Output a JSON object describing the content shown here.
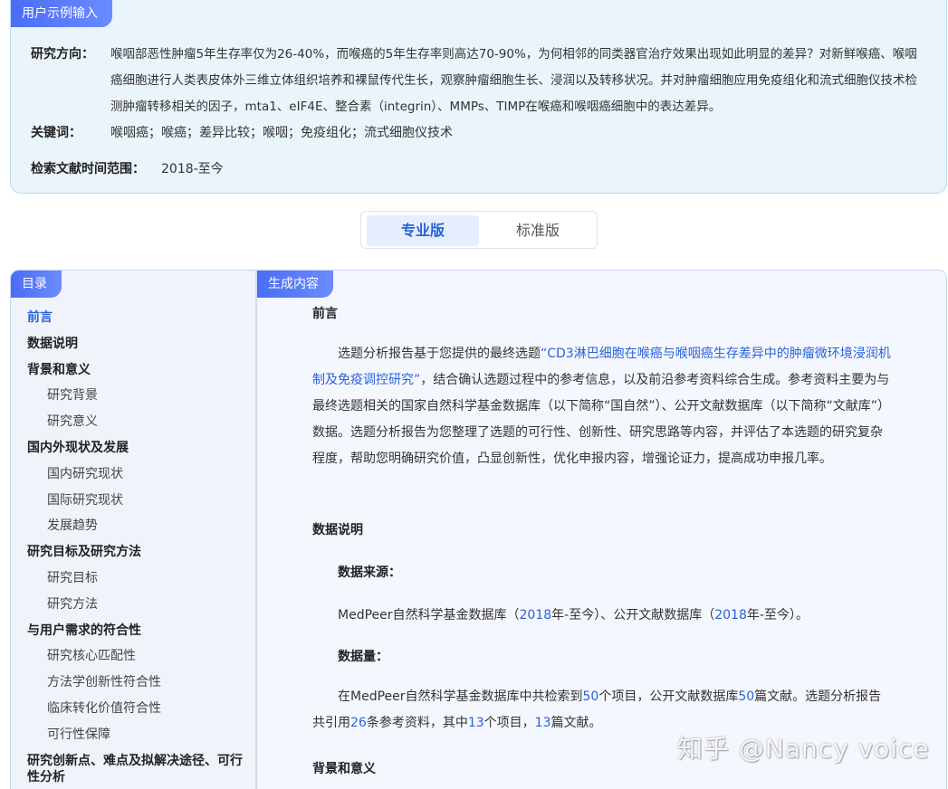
{
  "input_panel": {
    "tag": "用户示例输入",
    "direction_label": "研究方向：",
    "direction_text": "喉咽部恶性肿瘤5年生存率仅为26-40%，而喉癌的5年生存率则高达70-90%，为何相邻的同类器官治疗效果出现如此明显的差异？对新鲜喉癌、喉咽癌细胞进行人类表皮体外三维立体组织培养和裸鼠传代生长，观察肿瘤细胞生长、浸润以及转移状况。并对肿瘤细胞应用免疫组化和流式细胞仪技术检测肿瘤转移相关的因子，mta1、eIF4E、整合素（integrin）、MMPs、TIMP在喉癌和喉咽癌细胞中的表达差异。",
    "keywords_label": "关键词：",
    "keywords_text": "喉咽癌；喉癌；差异比较；喉咽；免疫组化；流式细胞仪技术",
    "range_label": "检索文献时间范围：",
    "range_text": "2018-至今"
  },
  "toggle": {
    "pro_label": "专业版",
    "std_label": "标准版"
  },
  "toc": {
    "tag": "目录",
    "items": [
      {
        "label": "前言",
        "level": 1,
        "active": true
      },
      {
        "label": "数据说明",
        "level": 1
      },
      {
        "label": "背景和意义",
        "level": 1
      },
      {
        "label": "研究背景",
        "level": 2
      },
      {
        "label": "研究意义",
        "level": 2
      },
      {
        "label": "国内外现状及发展",
        "level": 1
      },
      {
        "label": "国内研究现状",
        "level": 2
      },
      {
        "label": "国际研究现状",
        "level": 2
      },
      {
        "label": "发展趋势",
        "level": 2
      },
      {
        "label": "研究目标及研究方法",
        "level": 1
      },
      {
        "label": "研究目标",
        "level": 2
      },
      {
        "label": "研究方法",
        "level": 2
      },
      {
        "label": "与用户需求的符合性",
        "level": 1
      },
      {
        "label": "研究核心匹配性",
        "level": 2
      },
      {
        "label": "方法学创新性符合性",
        "level": 2
      },
      {
        "label": "临床转化价值符合性",
        "level": 2
      },
      {
        "label": "可行性保障",
        "level": 2
      },
      {
        "label": "研究创新点、难点及拟解决途径、可行性分析",
        "level": 1
      }
    ]
  },
  "content": {
    "tag": "生成内容",
    "preface_title": "前言",
    "preface_p1": "选题分析报告基于您提供的最终选题",
    "preface_topic": "“CD3淋巴细胞在喉癌与喉咽癌生存差异中的肿瘤微环境浸润机制及免疫调控研究”",
    "preface_p2": "，结合确认选题过程中的参考信息，以及前沿参考资料综合生成。参考资料主要为与最终选题相关的国家自然科学基金数据库（以下简称“国自然”）、公开文献数据库（以下简称“文献库”）数据。选题分析报告为您整理了选题的可行性、创新性、研究思路等内容，并评估了本选题的研究复杂程度，帮助您明确研究价值，凸显创新性，优化申报内容，增强论证力，提高成功申报几率。",
    "data_title": "数据说明",
    "source_title": "数据来源：",
    "source_a": "MedPeer自然科学基金数据库（",
    "source_year1": "2018",
    "source_b": "年-至今）、公开文献数据库（",
    "source_year2": "2018",
    "source_c": "年-至今）。",
    "volume_title": "数据量：",
    "vol_a": "在MedPeer自然科学基金数据库中共检索到",
    "vol_n1": "50",
    "vol_b": "个项目，公开文献数据库",
    "vol_n2": "50",
    "vol_c": "篇文献。选题分析报告共引用",
    "vol_n3": "26",
    "vol_d": "条参考资料，其中",
    "vol_n4": "13",
    "vol_e": "个项目，",
    "vol_n5": "13",
    "vol_f": "篇文献。",
    "bg_title": "背景和意义"
  },
  "watermark": "知乎 @Nancy voice",
  "colors": {
    "accent": "#2a62d8",
    "tag_gradient_start": "#4b6cf5",
    "panel_bg": "#eaf4fb"
  }
}
